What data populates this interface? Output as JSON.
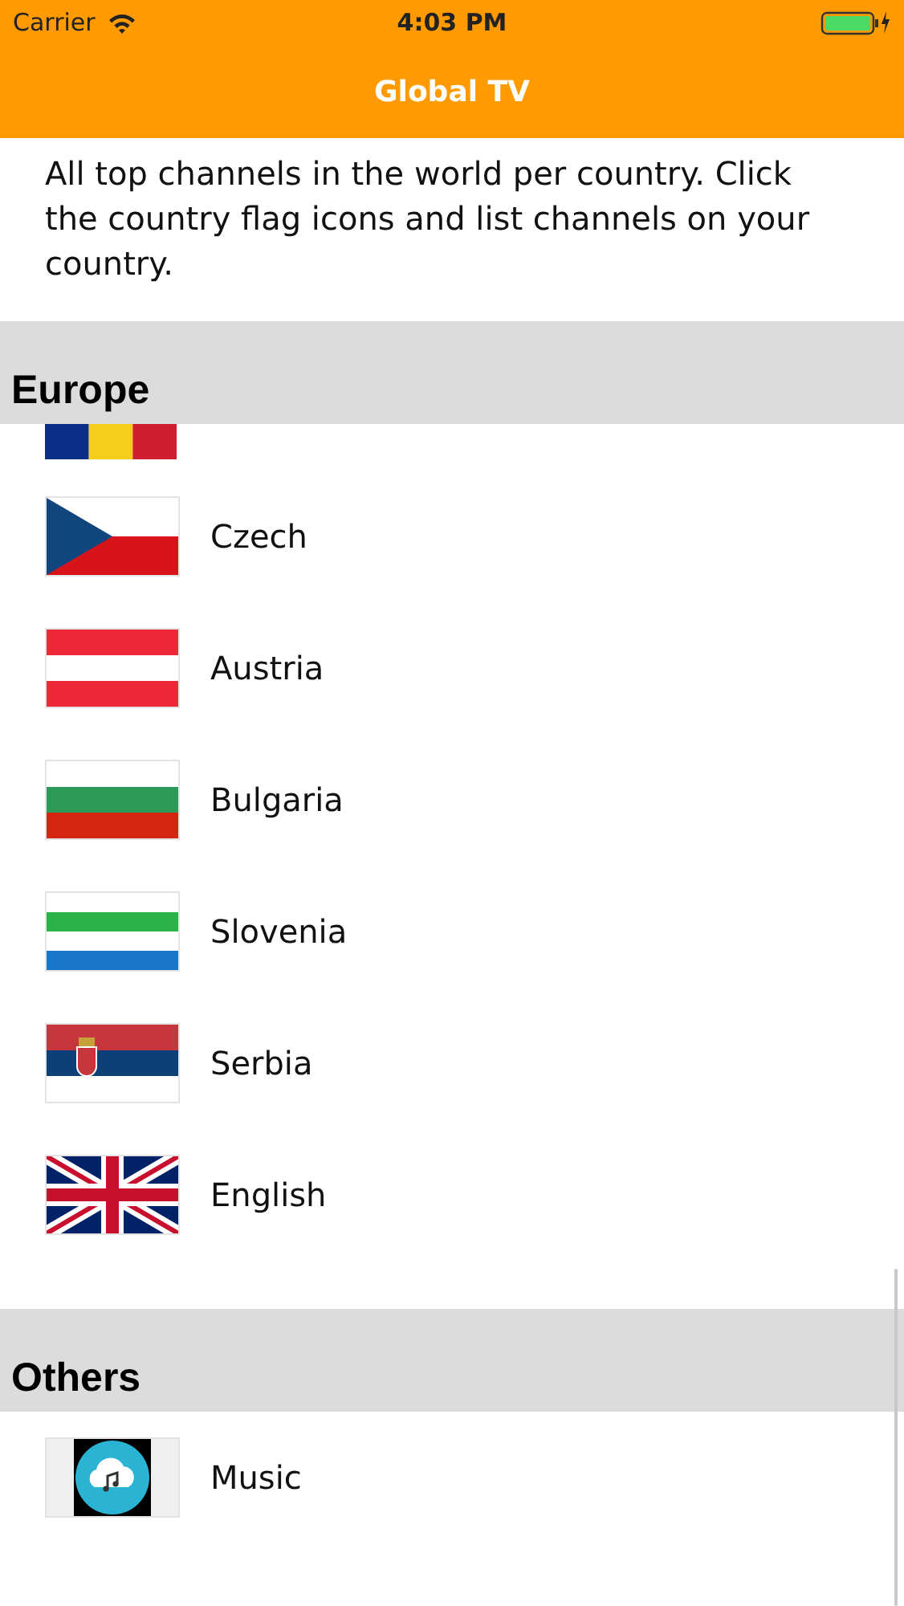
{
  "status_bar": {
    "carrier": "Carrier",
    "time": "4:03 PM"
  },
  "nav": {
    "title": "Global TV"
  },
  "description": "All top channels in the world per country. Click the country flag icons and list channels on your country.",
  "sections": [
    {
      "title": "Europe",
      "partial_row": {
        "kind": "romania"
      },
      "items": [
        {
          "label": "Czech",
          "kind": "czech"
        },
        {
          "label": "Austria",
          "kind": "austria"
        },
        {
          "label": "Bulgaria",
          "kind": "bulgaria"
        },
        {
          "label": "Slovenia",
          "kind": "slovenia"
        },
        {
          "label": "Serbia",
          "kind": "serbia"
        },
        {
          "label": "English",
          "kind": "uk"
        }
      ]
    },
    {
      "title": "Others",
      "items": [
        {
          "label": "Music",
          "kind": "music"
        }
      ]
    }
  ]
}
